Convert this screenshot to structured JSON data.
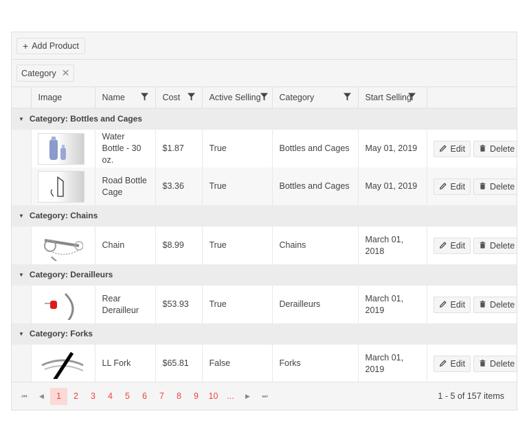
{
  "toolbar": {
    "add_label": "Add Product",
    "add_icon": "plus-icon"
  },
  "grouping": {
    "chip_label": "Category",
    "remove_icon": "close-icon"
  },
  "columns": [
    {
      "label": "Image",
      "filter": false
    },
    {
      "label": "Name",
      "filter": true
    },
    {
      "label": "Cost",
      "filter": true
    },
    {
      "label": "Active Selling",
      "filter": true
    },
    {
      "label": "Category",
      "filter": true
    },
    {
      "label": "Start Selling",
      "filter": true
    },
    {
      "label": "",
      "filter": false
    }
  ],
  "groups": [
    {
      "title": "Category: Bottles and Cages",
      "rows": [
        {
          "image": "water-bottle-image",
          "name": "Water Bottle - 30 oz.",
          "cost": "$1.87",
          "active": "True",
          "category": "Bottles and Cages",
          "start": "May 01, 2019"
        },
        {
          "image": "road-bottle-cage-image",
          "name": "Road Bottle Cage",
          "cost": "$3.36",
          "active": "True",
          "category": "Bottles and Cages",
          "start": "May 01, 2019"
        }
      ]
    },
    {
      "title": "Category: Chains",
      "rows": [
        {
          "image": "chain-image",
          "name": "Chain",
          "cost": "$8.99",
          "active": "True",
          "category": "Chains",
          "start": "March 01, 2018"
        }
      ]
    },
    {
      "title": "Category: Derailleurs",
      "rows": [
        {
          "image": "rear-derailleur-image",
          "name": "Rear Derailleur",
          "cost": "$53.93",
          "active": "True",
          "category": "Derailleurs",
          "start": "March 01, 2019"
        }
      ]
    },
    {
      "title": "Category: Forks",
      "rows": [
        {
          "image": "ll-fork-image",
          "name": "LL Fork",
          "cost": "$65.81",
          "active": "False",
          "category": "Forks",
          "start": "March 01, 2019"
        }
      ]
    }
  ],
  "row_actions": {
    "edit_label": "Edit",
    "delete_label": "Delete"
  },
  "pager": {
    "pages": [
      "1",
      "2",
      "3",
      "4",
      "5",
      "6",
      "7",
      "8",
      "9",
      "10",
      "..."
    ],
    "current": "1",
    "info": "1 - 5 of 157 items"
  },
  "colors": {
    "accent": "#ef4444",
    "active_page_bg": "#fbd9d7",
    "group_bg": "#ececec"
  }
}
